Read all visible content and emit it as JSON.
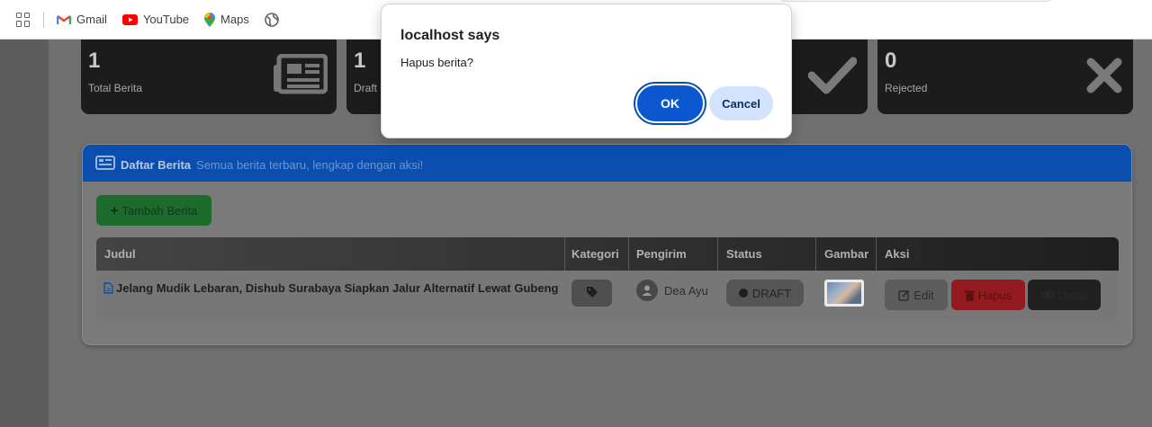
{
  "bookmarks": {
    "items": [
      {
        "label": "Gmail",
        "icon": "gmail-icon"
      },
      {
        "label": "YouTube",
        "icon": "youtube-icon"
      },
      {
        "label": "Maps",
        "icon": "maps-icon"
      }
    ]
  },
  "stats": [
    {
      "value": "1",
      "label": "Total Berita",
      "icon": "newspaper-icon"
    },
    {
      "value": "1",
      "label": "Draft",
      "icon": "file-icon"
    },
    {
      "value": "",
      "label": "",
      "icon": "check-icon"
    },
    {
      "value": "0",
      "label": "Rejected",
      "icon": "x-icon"
    }
  ],
  "card": {
    "title": "Daftar Berita",
    "subtitle": "Semua berita terbaru, lengkap dengan aksi!",
    "add_button": "Tambah Berita"
  },
  "table": {
    "headers": [
      "Judul",
      "Kategori",
      "Pengirim",
      "Status",
      "Gambar",
      "Aksi"
    ],
    "rows": [
      {
        "judul": "Jelang Mudik Lebaran, Dishub Surabaya Siapkan Jalur Alternatif Lewat Gubeng",
        "pengirim": "Dea Ayu",
        "status": "DRAFT",
        "actions": {
          "edit": "Edit",
          "hapus": "Hapus",
          "detail": "Detail"
        }
      }
    ]
  },
  "dialog": {
    "title": "localhost says",
    "message": "Hapus berita?",
    "ok": "OK",
    "cancel": "Cancel",
    "ok_color": "#0b57d0",
    "cancel_color": "#d3e3fd"
  },
  "colors": {
    "card_header": "#0a4fb0",
    "add_button": "#1c6a2c",
    "hapus_button": "#931a1e"
  }
}
